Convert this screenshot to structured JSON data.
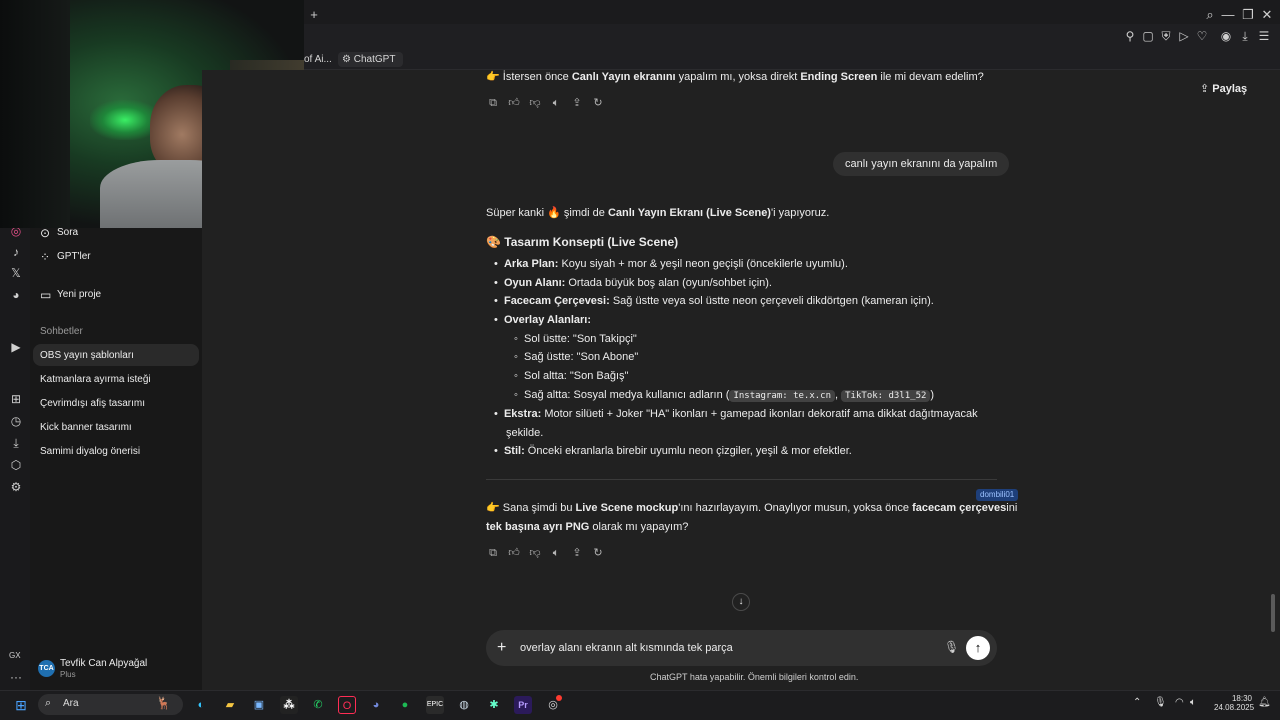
{
  "browser": {
    "url_fragment": "537a766da0",
    "bookmarks": [
      {
        "label": "of Ai..."
      },
      {
        "label": "ChatGPT"
      }
    ]
  },
  "sidebar": {
    "top_items": [
      {
        "label": "Sora",
        "icon": "play-circle-icon"
      },
      {
        "label": "GPT'ler",
        "icon": "grid-icon"
      }
    ],
    "new_project": "Yeni proje",
    "section_title": "Sohbetler",
    "chats": [
      {
        "label": "OBS yayın şablonları",
        "active": true
      },
      {
        "label": "Katmanlara ayırma isteği",
        "active": false
      },
      {
        "label": "Çevrimdışı afiş tasarımı",
        "active": false
      },
      {
        "label": "Kick banner tasarımı",
        "active": false
      },
      {
        "label": "Samimi diyalog önerisi",
        "active": false
      }
    ],
    "user": {
      "initials": "TCA",
      "name": "Tevfik Can Alpyağal",
      "plan": "Plus"
    },
    "gx_label": "GX"
  },
  "header": {
    "share_label": "Paylaş"
  },
  "conversation": {
    "prev_assistant_line": {
      "pre": "İstersen önce ",
      "b1": "Canlı Yayın ekranını",
      "mid": " yapalım mı, yoksa direkt ",
      "b2": "Ending Screen",
      "post": " ile mi devam edelim?"
    },
    "user_message": "canlı yayın ekranını da yapalım",
    "intro": {
      "pre": "Süper kanki ",
      "mid": " şimdi de ",
      "b1": "Canlı Yayın Ekranı (Live Scene)",
      "post": "'i yapıyoruz."
    },
    "heading": "Tasarım Konsepti (Live Scene)",
    "bullets": [
      {
        "label": "Arka Plan:",
        "text": " Koyu siyah + mor & yeşil neon geçişli (öncekilerle uyumlu)."
      },
      {
        "label": "Oyun Alanı:",
        "text": " Ortada büyük boş alan (oyun/sohbet için)."
      },
      {
        "label": "Facecam Çerçevesi:",
        "text": " Sağ üstte veya sol üstte neon çerçeveli dikdörtgen (kameran için)."
      },
      {
        "label": "Overlay Alanları:",
        "text": ""
      }
    ],
    "sub_bullets": [
      "Sol üstte: \"Son Takipçi\"",
      "Sağ üstte: \"Son Abone\"",
      "Sol altta: \"Son Bağış\""
    ],
    "social": {
      "pre": "Sağ altta: Sosyal medya kullanıcı adların (",
      "code1": "Instagram: te.x.cn",
      "sep": ", ",
      "code2": "TikTok: d3l1_52",
      "post": ")"
    },
    "bullets2": [
      {
        "label": "Ekstra:",
        "text": " Motor silüeti + Joker \"HA\" ikonları + gamepad ikonları dekoratif ama dikkat dağıtmayacak",
        "cont": "şekilde."
      },
      {
        "label": "Stil:",
        "text": " Önceki ekranlarla birebir uyumlu neon çizgiler, yeşil & mor efektler."
      }
    ],
    "closing": {
      "pre": "Sana şimdi bu ",
      "b1": "Live Scene mockup",
      "mid": "'ını hazırlayayım. Onaylıyor musun, yoksa önce ",
      "b2": "facecam çerçeves",
      "tail": "ini",
      "b3": "tek başına ayrı PNG",
      "post": " olarak mı yapayım?"
    },
    "tooltip": "dombili01"
  },
  "composer": {
    "value": "overlay alanı ekranın alt kısmında tek parça",
    "disclaimer": "ChatGPT hata yapabilir. Önemli bilgileri kontrol edin."
  },
  "taskbar": {
    "search_label": "Ara",
    "time": "18:30",
    "date": "24.08.2025"
  },
  "colors": {
    "bg": "#212121",
    "sidebar": "#181818",
    "bubble": "#303030"
  }
}
